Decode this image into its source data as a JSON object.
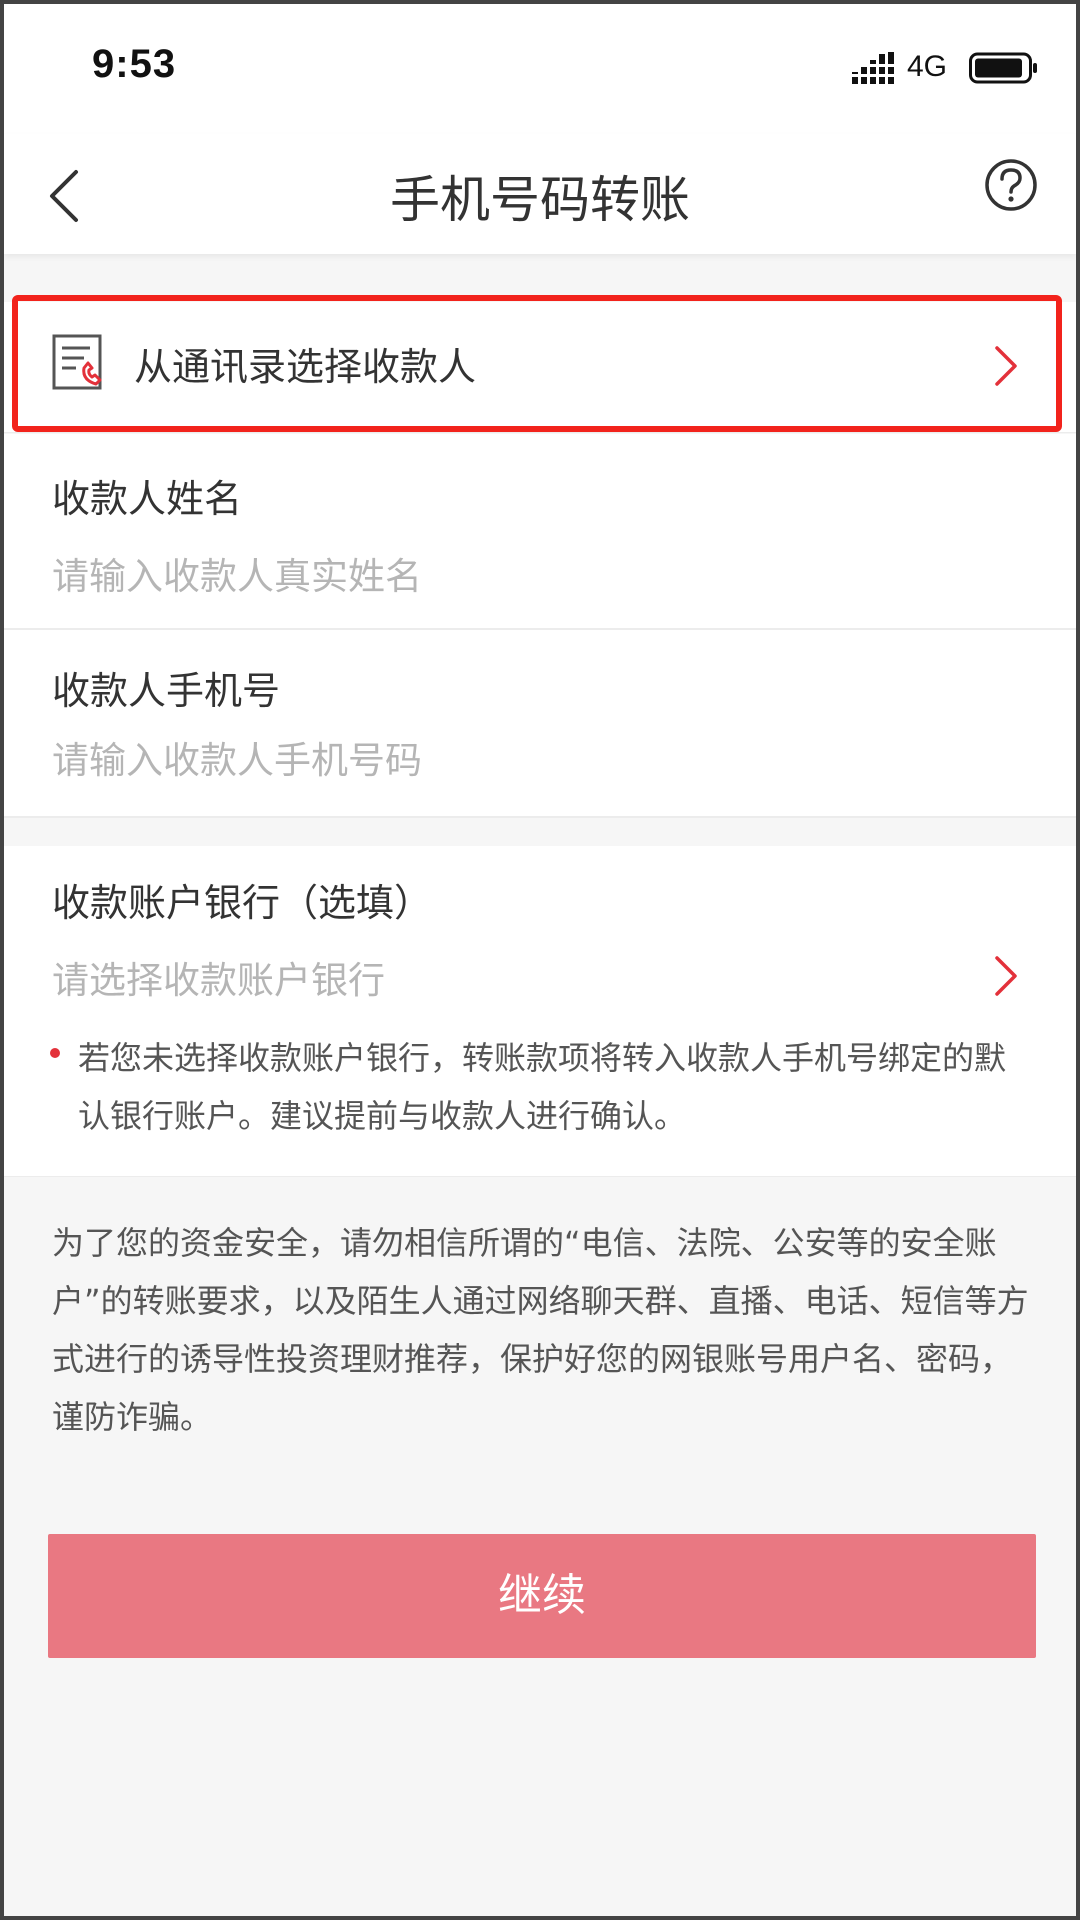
{
  "status_bar": {
    "time": "9:53",
    "network": "4G",
    "icons": [
      "signal-icon",
      "battery-icon"
    ]
  },
  "nav": {
    "title": "手机号码转账",
    "back_icon": "chevron-left-icon",
    "help_icon": "question-circle-icon"
  },
  "contact_picker": {
    "label": "从通讯录选择收款人",
    "icon": "contact-book-icon",
    "highlight_color": "#f2231c"
  },
  "payee_name": {
    "label": "收款人姓名",
    "placeholder": "请输入收款人真实姓名"
  },
  "payee_phone": {
    "label": "收款人手机号",
    "placeholder": "请输入收款人手机号码"
  },
  "bank": {
    "label": "收款账户银行（选填）",
    "placeholder": "请选择收款账户银行",
    "note": "若您未选择收款账户银行，转账款项将转入收款人手机号绑定的默认银行账户。建议提前与收款人进行确认。"
  },
  "warning": "为了您的资金安全，请勿相信所谓的“电信、法院、公安等的安全账户”的转账要求，以及陌生人通过网络聊天群、直播、电话、短信等方式进行的诱导性投资理财推荐，保护好您的网银账号用户名、密码，谨防诈骗。",
  "continue_button": "继续",
  "colors": {
    "accent_red": "#e3313a",
    "button": "#e97882",
    "background": "#f6f6f6"
  }
}
